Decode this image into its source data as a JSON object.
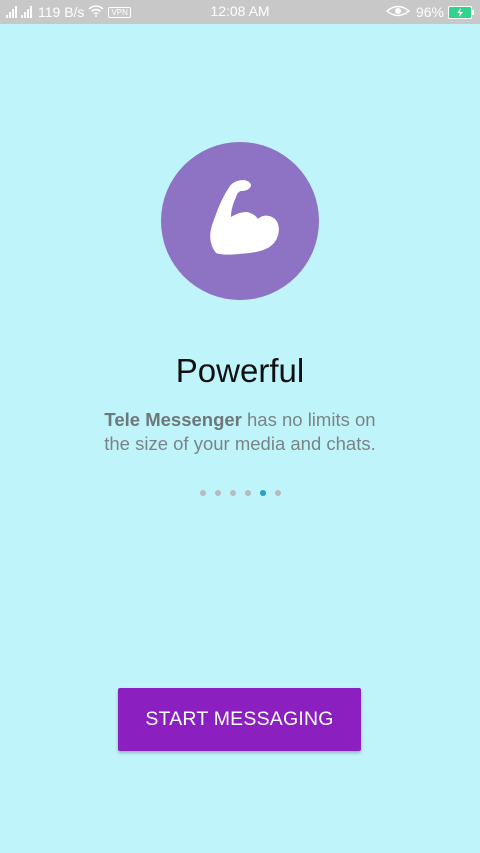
{
  "status_bar": {
    "net_speed": "119 B/s",
    "vpn_label": "VPN",
    "time": "12:08 AM",
    "battery_percent": "96%",
    "battery_level": 0.96,
    "icons": [
      "signal-icon",
      "signal-icon",
      "wifi-icon",
      "vpn-icon",
      "eye-icon",
      "battery-icon"
    ],
    "background_color": "#c8c8c8"
  },
  "onboarding": {
    "icon": "flexed-arm-icon",
    "icon_bg_color": "#8e72c3",
    "title": "Powerful",
    "description_bold": "Tele Messenger",
    "description_rest_line1": " has no limits on",
    "description_line2": "the size of your media and chats.",
    "page_count": 6,
    "active_page": 5
  },
  "start_button": {
    "label": "START MESSAGING",
    "color": "#8b1fbf"
  },
  "background_color": "#c0f4fb"
}
